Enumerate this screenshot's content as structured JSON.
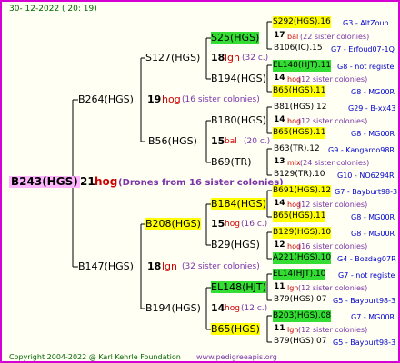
{
  "date": "30- 12-2022 ( 20: 19)",
  "root": {
    "id": "B243(HGS)",
    "gen": "21",
    "lineage": "hog",
    "note": "(Drones from 16 sister colonies)"
  },
  "gen1": [
    {
      "id": "B264(HGS)",
      "gen": "19",
      "lineage": "hog",
      "note": "(16 sister colonies)"
    },
    {
      "id": "B147(HGS)",
      "gen": "18",
      "lineage": "lgn",
      "note": "(32 sister colonies)"
    }
  ],
  "gen2": [
    {
      "id": "S127(HGS)",
      "gen": "18",
      "lineage": "lgn",
      "note": "(32 c.)"
    },
    {
      "id": "B56(HGS)",
      "gen": "15",
      "lineage": "bal",
      "note": "(20 c.)"
    },
    {
      "id": "B208(HGS)",
      "gen": "15",
      "lineage": "hog",
      "note": "(16 c.)"
    },
    {
      "id": "B194(HGS)",
      "gen": "14",
      "lineage": "hog",
      "note": "(12 c.)"
    }
  ],
  "gen3": [
    {
      "id": "S25(HGS)"
    },
    {
      "id": "B194(HGS)"
    },
    {
      "id": "B180(HGS)"
    },
    {
      "id": "B69(TR)"
    },
    {
      "id": "B184(HGS)"
    },
    {
      "id": "B29(HGS)"
    },
    {
      "id": "EL148(HJT)"
    },
    {
      "id": "B65(HGS)"
    }
  ],
  "gen4": [
    {
      "id": "S292(HGS).16",
      "info": "G3 - AltZoun"
    },
    {
      "gen": "17",
      "lineage": "bal",
      "note": "(22 sister colonies)"
    },
    {
      "id": "B106(IC).15",
      "info": "G7 - Erfoud07-1Q"
    },
    {
      "id": "EL148(HJT).11",
      "info": "G8 - not registe"
    },
    {
      "gen": "14",
      "lineage": "hog",
      "note": "(12 sister colonies)"
    },
    {
      "id": "B65(HGS).11",
      "info": "G8 - MG00R"
    },
    {
      "id": "B81(HGS).12",
      "info": "G29 - B-xx43"
    },
    {
      "gen": "14",
      "lineage": "hog",
      "note": "(12 sister colonies)"
    },
    {
      "id": "B65(HGS).11",
      "info": "G8 - MG00R"
    },
    {
      "id": "B63(TR).12",
      "info": "G9 - Kangaroo98R"
    },
    {
      "gen": "13",
      "lineage": "mix",
      "note": "(24 sister colonies)"
    },
    {
      "id": "B129(TR).10",
      "info": "G10 - NO6294R"
    },
    {
      "id": "B691(HGS).12",
      "info": "G7 - Bayburt98-3"
    },
    {
      "gen": "14",
      "lineage": "hog",
      "note": "(12 sister colonies)"
    },
    {
      "id": "B65(HGS).11",
      "info": "G8 - MG00R"
    },
    {
      "id": "B129(HGS).10",
      "info": "G8 - MG00R"
    },
    {
      "gen": "12",
      "lineage": "hog",
      "note": "(16 sister colonies)"
    },
    {
      "id": "A221(HGS).10",
      "info": "G4 - Bozdag07R"
    },
    {
      "id": "EL14(HJT).10",
      "info": "G7 - not registe"
    },
    {
      "gen": "11",
      "lineage": "lgn",
      "note": "(12 sister colonies)"
    },
    {
      "id": "B79(HGS).07",
      "info": "G5 - Bayburt98-3"
    },
    {
      "id": "B203(HGS).08",
      "info": "G7 - MG00R"
    },
    {
      "gen": "11",
      "lineage": "lgn",
      "note": "(12 sister colonies)"
    },
    {
      "id": "B79(HGS).07",
      "info": "G5 - Bayburt98-3"
    }
  ],
  "footer": {
    "copyright": "Copyright 2004-2022 @ Karl Kehrle Foundation",
    "url": "www.pedigreeapis.org"
  }
}
